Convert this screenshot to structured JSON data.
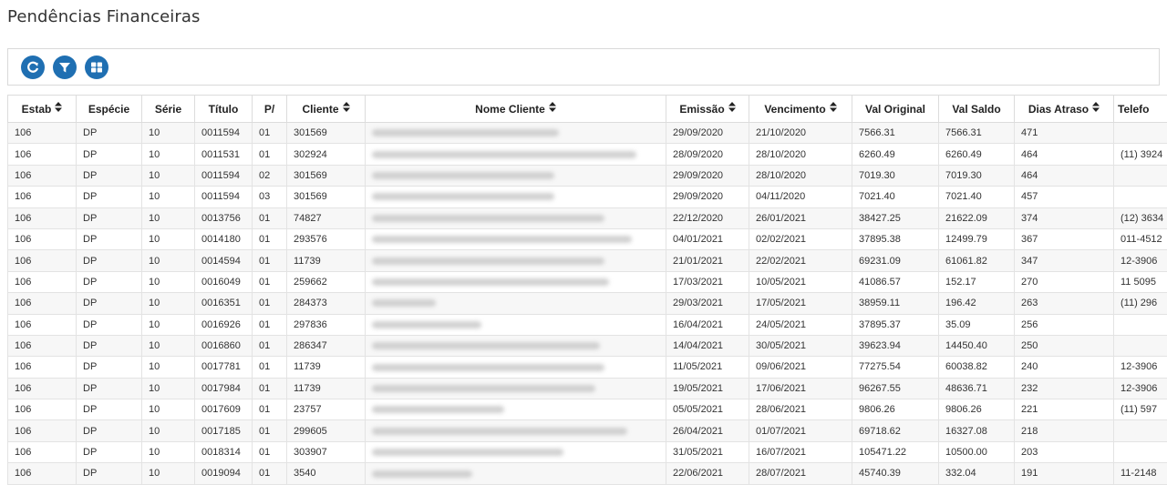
{
  "page": {
    "title": "Pendências Financeiras"
  },
  "toolbar": {
    "buttons": [
      {
        "name": "refresh-button",
        "icon": "refresh-icon"
      },
      {
        "name": "filter-button",
        "icon": "filter-icon"
      },
      {
        "name": "grid-view-button",
        "icon": "grid-icon"
      }
    ],
    "accent": "#1f6fb2"
  },
  "table": {
    "columns": [
      {
        "key": "estab",
        "label": "Estab",
        "sortable": true
      },
      {
        "key": "especie",
        "label": "Espécie",
        "sortable": false
      },
      {
        "key": "serie",
        "label": "Série",
        "sortable": false
      },
      {
        "key": "titulo",
        "label": "Título",
        "sortable": false
      },
      {
        "key": "parcela",
        "label": "P/",
        "sortable": false
      },
      {
        "key": "cliente",
        "label": "Cliente",
        "sortable": true
      },
      {
        "key": "nome",
        "label": "Nome Cliente",
        "sortable": true
      },
      {
        "key": "emissao",
        "label": "Emissão",
        "sortable": true
      },
      {
        "key": "vencimento",
        "label": "Vencimento",
        "sortable": true
      },
      {
        "key": "val_original",
        "label": "Val Original",
        "sortable": false
      },
      {
        "key": "val_saldo",
        "label": "Val Saldo",
        "sortable": false
      },
      {
        "key": "dias_atraso",
        "label": "Dias Atraso",
        "sortable": true
      },
      {
        "key": "telefone",
        "label": "Telefo",
        "sortable": false
      }
    ],
    "rows": [
      [
        "106",
        "DP",
        "10",
        "0011594",
        "01",
        "301569",
        "",
        "29/09/2020",
        "21/10/2020",
        "7566.31",
        "7566.31",
        "471",
        ""
      ],
      [
        "106",
        "DP",
        "10",
        "0011531",
        "01",
        "302924",
        "",
        "28/09/2020",
        "28/10/2020",
        "6260.49",
        "6260.49",
        "464",
        "(11) 3924"
      ],
      [
        "106",
        "DP",
        "10",
        "0011594",
        "02",
        "301569",
        "",
        "29/09/2020",
        "28/10/2020",
        "7019.30",
        "7019.30",
        "464",
        ""
      ],
      [
        "106",
        "DP",
        "10",
        "0011594",
        "03",
        "301569",
        "",
        "29/09/2020",
        "04/11/2020",
        "7021.40",
        "7021.40",
        "457",
        ""
      ],
      [
        "106",
        "DP",
        "10",
        "0013756",
        "01",
        "74827",
        "",
        "22/12/2020",
        "26/01/2021",
        "38427.25",
        "21622.09",
        "374",
        "(12) 3634"
      ],
      [
        "106",
        "DP",
        "10",
        "0014180",
        "01",
        "293576",
        "",
        "04/01/2021",
        "02/02/2021",
        "37895.38",
        "12499.79",
        "367",
        "011-4512"
      ],
      [
        "106",
        "DP",
        "10",
        "0014594",
        "01",
        "11739",
        "",
        "21/01/2021",
        "22/02/2021",
        "69231.09",
        "61061.82",
        "347",
        "12-3906"
      ],
      [
        "106",
        "DP",
        "10",
        "0016049",
        "01",
        "259662",
        "",
        "17/03/2021",
        "10/05/2021",
        "41086.57",
        "152.17",
        "270",
        "11 5095"
      ],
      [
        "106",
        "DP",
        "10",
        "0016351",
        "01",
        "284373",
        "",
        "29/03/2021",
        "17/05/2021",
        "38959.11",
        "196.42",
        "263",
        "(11) 296"
      ],
      [
        "106",
        "DP",
        "10",
        "0016926",
        "01",
        "297836",
        "",
        "16/04/2021",
        "24/05/2021",
        "37895.37",
        "35.09",
        "256",
        ""
      ],
      [
        "106",
        "DP",
        "10",
        "0016860",
        "01",
        "286347",
        "",
        "14/04/2021",
        "30/05/2021",
        "39623.94",
        "14450.40",
        "250",
        ""
      ],
      [
        "106",
        "DP",
        "10",
        "0017781",
        "01",
        "11739",
        "",
        "11/05/2021",
        "09/06/2021",
        "77275.54",
        "60038.82",
        "240",
        "12-3906"
      ],
      [
        "106",
        "DP",
        "10",
        "0017984",
        "01",
        "11739",
        "",
        "19/05/2021",
        "17/06/2021",
        "96267.55",
        "48636.71",
        "232",
        "12-3906"
      ],
      [
        "106",
        "DP",
        "10",
        "0017609",
        "01",
        "23757",
        "",
        "05/05/2021",
        "28/06/2021",
        "9806.26",
        "9806.26",
        "221",
        "(11) 597"
      ],
      [
        "106",
        "DP",
        "10",
        "0017185",
        "01",
        "299605",
        "",
        "26/04/2021",
        "01/07/2021",
        "69718.62",
        "16327.08",
        "218",
        ""
      ],
      [
        "106",
        "DP",
        "10",
        "0018314",
        "01",
        "303907",
        "",
        "31/05/2021",
        "16/07/2021",
        "105471.22",
        "10500.00",
        "203",
        ""
      ],
      [
        "106",
        "DP",
        "10",
        "0019094",
        "01",
        "3540",
        "",
        "22/06/2021",
        "28/07/2021",
        "45740.39",
        "332.04",
        "191",
        "11-2148"
      ]
    ]
  }
}
